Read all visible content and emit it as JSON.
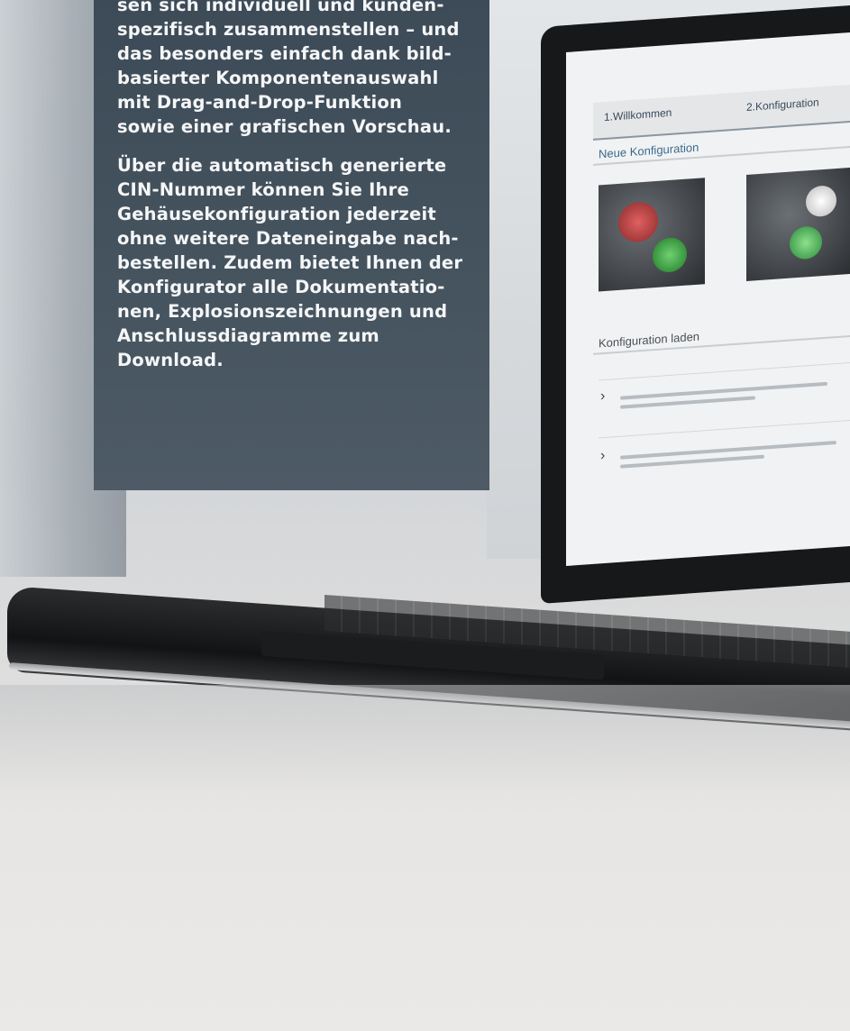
{
  "panel": {
    "paragraph1": "sen sich individuell und kunden-\nspezifisch zusammenstellen – und\ndas besonders einfach dank bild-\nbasierter Komponentenauswahl\nmit Drag-and-Drop-Funktion\nsowie einer grafischen Vorschau.",
    "paragraph2": "Über die automatisch generierte\nCIN-Nummer können Sie Ihre\nGehäusekonfiguration jederzeit\nohne weitere Dateneingabe nach-\nbestellen. Zudem bietet Ihnen der\nKonfigurator alle Dokumentatio-\nnen, Explosionszeichnungen und\nAnschlussdiagramme zum\nDownload."
  },
  "laptop_screen": {
    "tabs": [
      "1.Willkommen",
      "2.Konfiguration"
    ],
    "section_new": "Neue Konfiguration",
    "section_load": "Konfiguration laden"
  },
  "colors": {
    "panel": "#46545f",
    "panel_text": "#f5f6f7",
    "screen_heading": "#3c6a8c"
  }
}
